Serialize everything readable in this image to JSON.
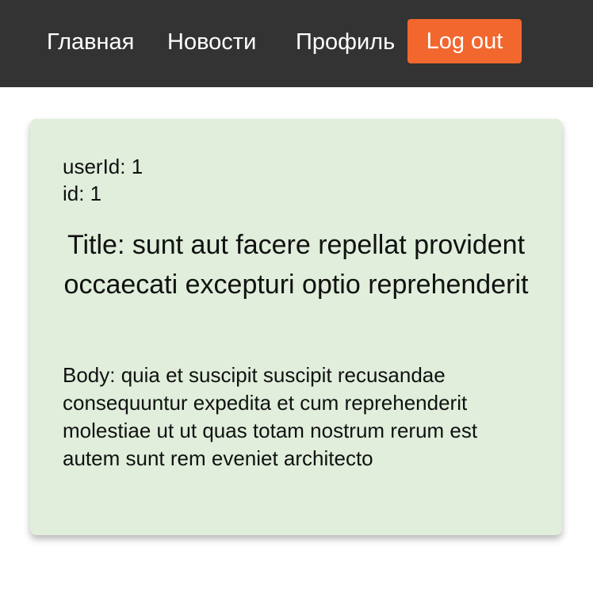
{
  "nav": {
    "home_label": "Главная",
    "news_label": "Новости",
    "profile_label": "Профиль",
    "logout_label": "Log out",
    "logout_color": "#f2672e",
    "bar_color": "#333333"
  },
  "post": {
    "user_id_text": "userId: 1",
    "id_text": "id: 1",
    "title_text": "Title: sunt aut facere repellat provident occaecati excepturi optio reprehenderit",
    "body_text": "Body: quia et suscipit suscipit recusandae consequuntur expedita et cum reprehenderit molestiae ut ut quas totam nostrum rerum est autem sunt rem eveniet architecto",
    "card_color": "#e0eedb"
  }
}
